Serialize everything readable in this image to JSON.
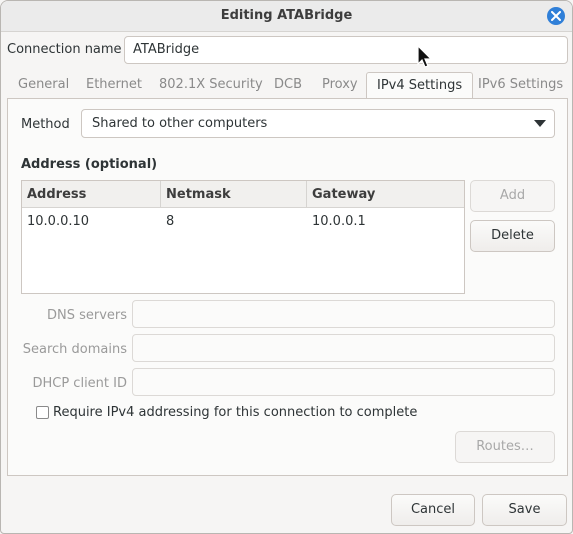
{
  "window": {
    "title": "Editing ATABridge"
  },
  "connection": {
    "label": "Connection name",
    "value": "ATABridge"
  },
  "tabs": [
    {
      "label": "General"
    },
    {
      "label": "Ethernet"
    },
    {
      "label": "802.1X Security"
    },
    {
      "label": "DCB"
    },
    {
      "label": "Proxy"
    },
    {
      "label": "IPv4 Settings",
      "active": true
    },
    {
      "label": "IPv6 Settings"
    }
  ],
  "method": {
    "label": "Method",
    "value": "Shared to other computers"
  },
  "addresses": {
    "heading": "Address (optional)",
    "columns": [
      "Address",
      "Netmask",
      "Gateway"
    ],
    "rows": [
      [
        "10.0.0.10",
        "8",
        "10.0.0.1"
      ]
    ],
    "add_label": "Add",
    "delete_label": "Delete"
  },
  "fields": {
    "dns_label": "DNS servers",
    "search_label": "Search domains",
    "dhcp_label": "DHCP client ID"
  },
  "require_ipv4": {
    "label": "Require IPv4 addressing for this connection to complete",
    "checked": false
  },
  "routes_label": "Routes…",
  "footer": {
    "cancel_label": "Cancel",
    "save_label": "Save"
  },
  "colors": {
    "accent": "#2f7fd8"
  }
}
